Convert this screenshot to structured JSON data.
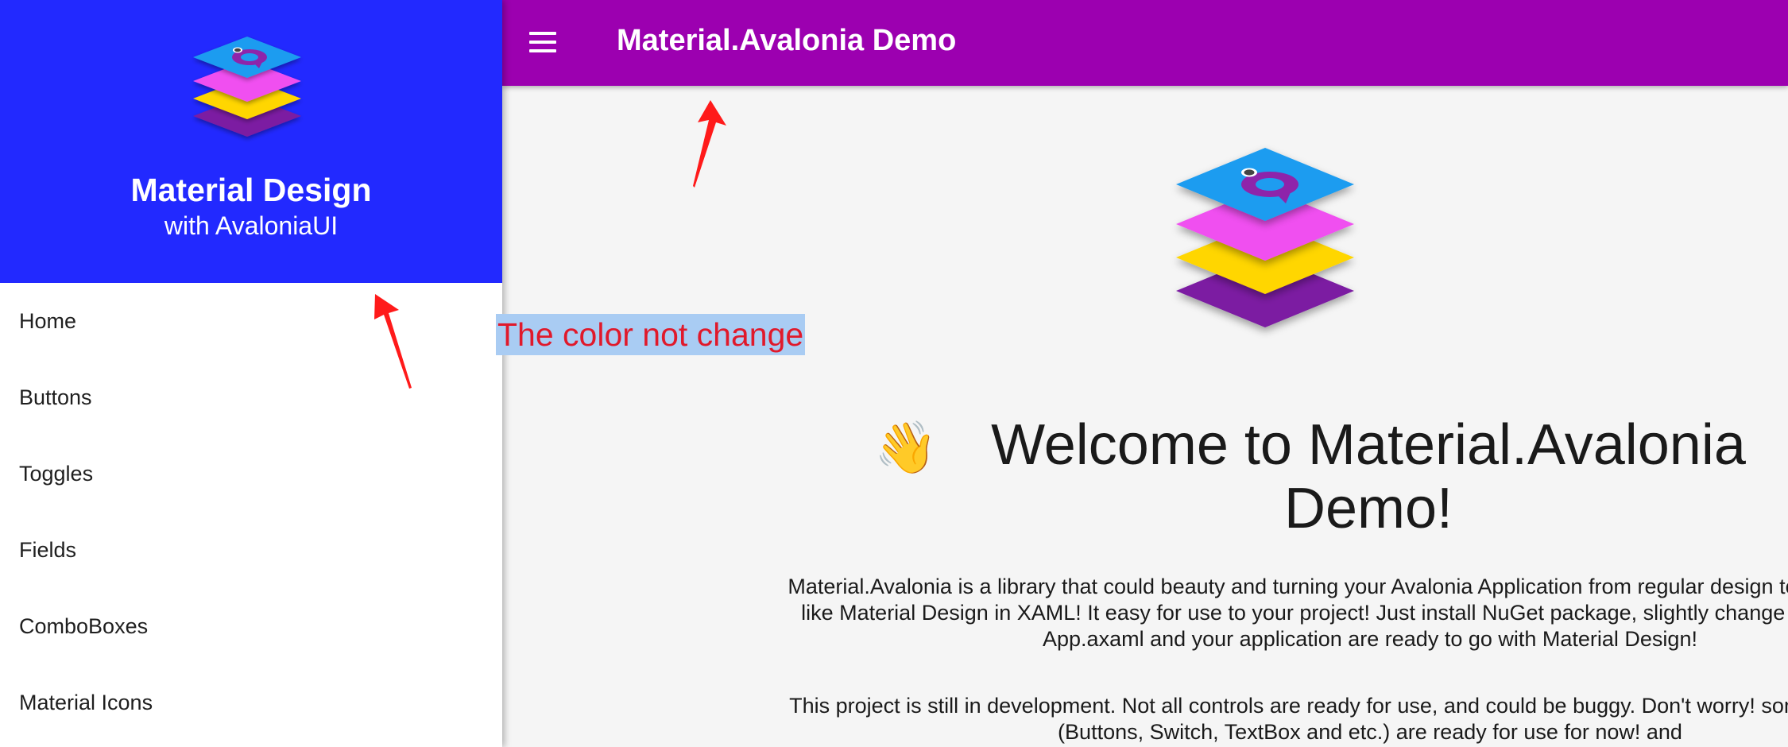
{
  "drawer": {
    "title": "Material Design",
    "subtitle": "with AvaloniaUI",
    "header_color": "#2229ff",
    "logo_icon": "material-avalonia-logo",
    "items": [
      {
        "label": "Home"
      },
      {
        "label": "Buttons"
      },
      {
        "label": "Toggles"
      },
      {
        "label": "Fields"
      },
      {
        "label": "ComboBoxes"
      },
      {
        "label": "Material Icons"
      }
    ]
  },
  "appbar": {
    "title": "Material.Avalonia Demo",
    "color": "#9c00b0",
    "menu_icon": "hamburger-menu-icon"
  },
  "main": {
    "logo_icon": "material-avalonia-logo",
    "emoji": "👋",
    "welcome_title": "Welcome to Material.Avalonia Demo!",
    "paragraph1": "Material.Avalonia is a library that could beauty and turning your Avalonia Application from regular design to Material Design like Material Design in XAML! It easy for use to your project! Just install NuGet package, slightly change your App.xaml / App.axaml and your application are ready to go with Material Design!",
    "paragraph2": "This project is still in development. Not all controls are ready for use, and could be buggy. Don't worry! some basic controls (Buttons, Switch, TextBox and etc.) are ready for use for now! and"
  },
  "annotation": {
    "note": "The color not change",
    "note_color": "#e0192b",
    "arrow_color": "#ff1a1a"
  }
}
